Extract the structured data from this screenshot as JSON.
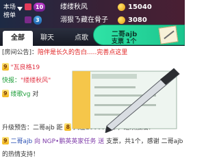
{
  "rank": {
    "title_line1": "本场",
    "title_line2": "榜单",
    "rows": [
      {
        "level": "10",
        "name": "缕缕秋风",
        "score": "15040"
      },
      {
        "level": "3",
        "name": "溺狠ㄋ藏在骨子",
        "score": "3080"
      }
    ]
  },
  "tabs": {
    "all": "全部",
    "chat": "聊天",
    "song": "点歌"
  },
  "gift": {
    "user": "二哥ajb",
    "count": "支票 1个"
  },
  "notice": {
    "label": "[房间公告]：",
    "text": "陪伴是长久的告白.....完善点这里"
  },
  "messages": [
    {
      "level": "9",
      "name": "\"瓦良格19",
      "text": ""
    },
    {
      "prefix": "快报：",
      "name": "\"缕缕秋风\"",
      "text": ""
    },
    {
      "level": "9",
      "name": "缕歌vg",
      "text": " 对"
    },
    {
      "text": "升级预告：二哥ajb 距",
      "level": "8",
      "tail": "只差10000六币，继续加油！"
    },
    {
      "level": "9",
      "name": "二哥ajb",
      "text_a": " 向 NGP•鹏英英家任务 送 ",
      "text_b": " 支票，共1个，感谢 二哥ajb"
    },
    {
      "text": "的热情支持！"
    }
  ],
  "colors": {
    "header_bg": "#1d2a44",
    "gift_bg": "#2fe3a6",
    "notice_red": "#e02020"
  }
}
